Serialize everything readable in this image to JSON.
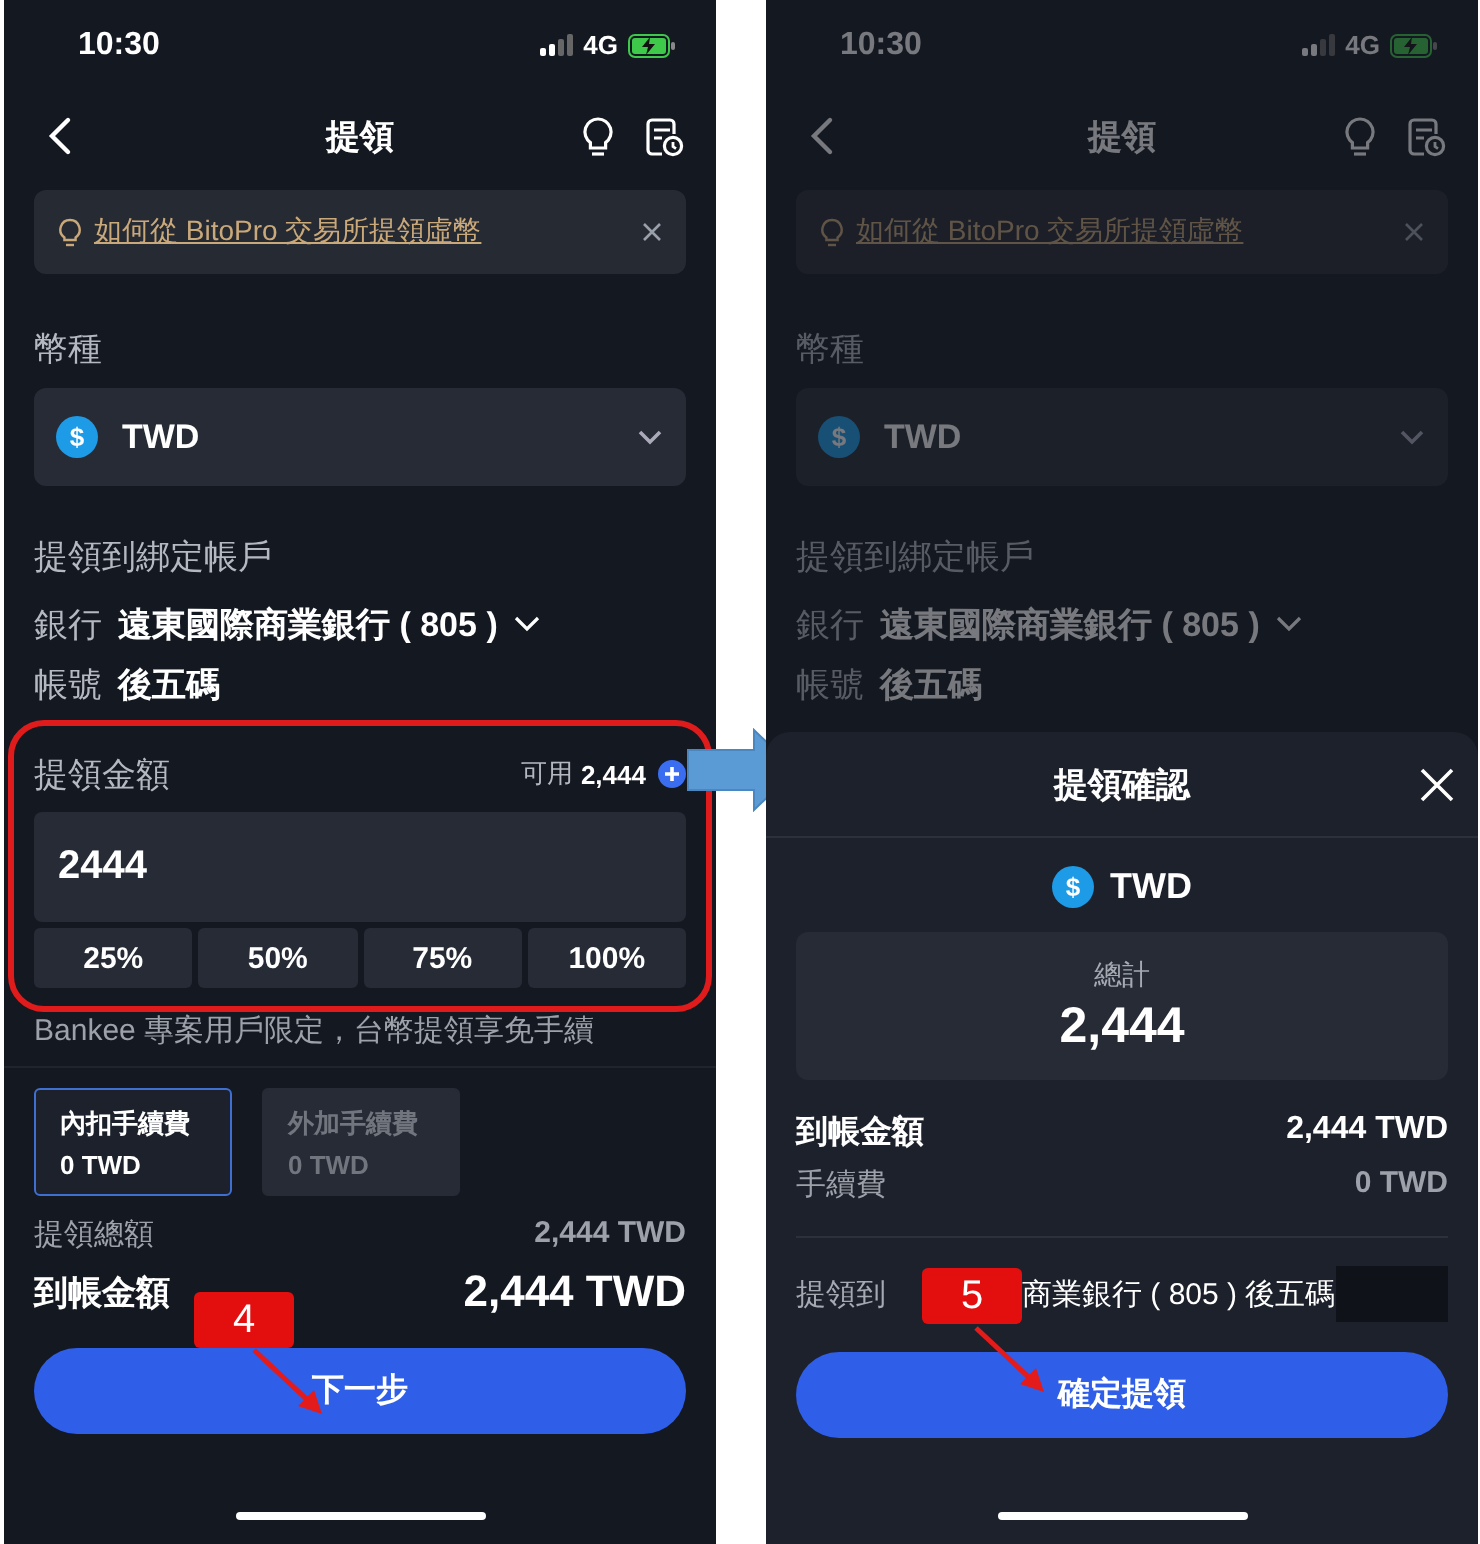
{
  "left_screen": {
    "status_bar": {
      "time": "10:30",
      "network": "4G"
    },
    "title": "提領",
    "banner": {
      "link": "如何從 BitoPro 交易所提領虛幣"
    },
    "currency_label": "幣種",
    "currency": {
      "symbol": "$",
      "code": "TWD"
    },
    "account_heading": "提領到綁定帳戶",
    "bank": {
      "label": "銀行",
      "value": "遠東國際商業銀行 ( 805 )"
    },
    "account": {
      "label": "帳號",
      "value": "後五碼"
    },
    "amount": {
      "label": "提領金額",
      "available_label": "可用",
      "available": "2,444",
      "value": "2444",
      "percentages": [
        {
          "label": "25%",
          "selected": false
        },
        {
          "label": "50%",
          "selected": false
        },
        {
          "label": "75%",
          "selected": false
        },
        {
          "label": "100%",
          "selected": false
        }
      ]
    },
    "promo": "Bankee 專案用戶限定，台幣提領享免手續",
    "fee_options": [
      {
        "title": "內扣手續費",
        "amount": "0 TWD",
        "selected": true
      },
      {
        "title": "外加手續費",
        "amount": "0 TWD",
        "selected": false
      }
    ],
    "summary": [
      {
        "label": "提領總額",
        "value": "2,444 TWD",
        "kind": "minor"
      },
      {
        "label": "到帳金額",
        "value": "2,444 TWD",
        "kind": "major"
      }
    ],
    "button": "下一步",
    "step_badge": "4"
  },
  "right_screen": {
    "dimmed": true,
    "status_bar": {
      "time": "10:30",
      "network": "4G"
    },
    "title": "提領",
    "banner": {
      "link": "如何從 BitoPro 交易所提領虛幣"
    },
    "currency_label": "幣種",
    "currency": {
      "symbol": "$",
      "code": "TWD"
    },
    "account_heading": "提領到綁定帳戶",
    "bank": {
      "label": "銀行",
      "value": "遠東國際商業銀行 ( 805 )"
    },
    "account": {
      "label": "帳號",
      "value": "後五碼"
    },
    "sheet": {
      "title": "提領確認",
      "currency": {
        "symbol": "$",
        "code": "TWD"
      },
      "total_label": "總計",
      "total": "2,444",
      "rows": [
        {
          "label": "到帳金額",
          "value": "2,444 TWD",
          "kind": "major"
        },
        {
          "label": "手續費",
          "value": "0 TWD",
          "kind": "minor"
        }
      ],
      "destination_label": "提領到",
      "destination_visible_end": "商業銀行 ( 805 ) 後五碼",
      "button": "確定提領",
      "step_badge": "5"
    }
  }
}
